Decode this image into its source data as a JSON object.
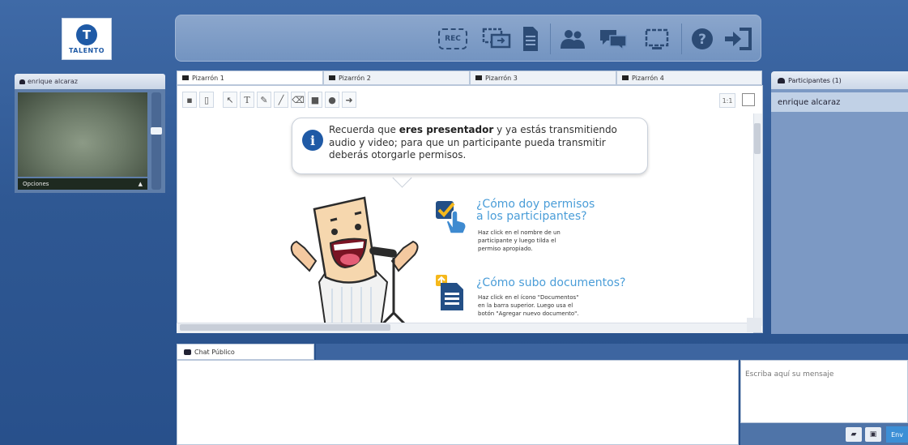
{
  "logo": {
    "initial": "T",
    "text": "TALENTO"
  },
  "toolbar": {
    "rec_label": "REC",
    "icons": [
      "record-icon",
      "share-screen-icon",
      "documents-icon",
      "participants-icon",
      "chat-icon",
      "layout-icon",
      "help-icon",
      "exit-icon"
    ]
  },
  "camera": {
    "user": "enrique alcaraz",
    "options_label": "Opciones",
    "options_arrow": "▲"
  },
  "whiteboard": {
    "tabs": [
      "Pizarrón 1",
      "Pizarrón 2",
      "Pizarrón 3",
      "Pizarrón 4"
    ],
    "zoom_label": "1:1",
    "tools": [
      "new-page-icon",
      "delete-icon",
      "select-icon",
      "text-icon",
      "pencil-icon",
      "line-icon",
      "eraser-icon",
      "rectangle-icon",
      "circle-icon",
      "arrow-icon"
    ]
  },
  "bubble": {
    "pre": "Recuerda que ",
    "bold": "eres presentador",
    "post": " y ya estás transmitiendo audio y video; para que un participante pueda transmitir deberás otorgarle permisos."
  },
  "help": {
    "q1_line1": "¿Cómo doy permisos",
    "q1_line2": "a los participantes?",
    "a1_line1": "Haz click en el nombre de un",
    "a1_line2": "participante y luego tilda el",
    "a1_line3": "permiso apropiado.",
    "q2": "¿Cómo subo documentos?",
    "a2_line1": "Haz click en el ícono \"Documentos\"",
    "a2_line2": "en la barra superior. Luego usa el",
    "a2_line3": "botón \"Agregar nuevo documento\"."
  },
  "participants": {
    "header": "Participantes (1)",
    "items": [
      "enrique alcaraz"
    ]
  },
  "chat": {
    "tab_label": "Chat Público",
    "placeholder": "Escriba aquí su mensaje",
    "send_label": "Env"
  },
  "colors": {
    "background": "#2f5893",
    "accent": "#4a9dd8",
    "brand": "#1f5aa6"
  }
}
